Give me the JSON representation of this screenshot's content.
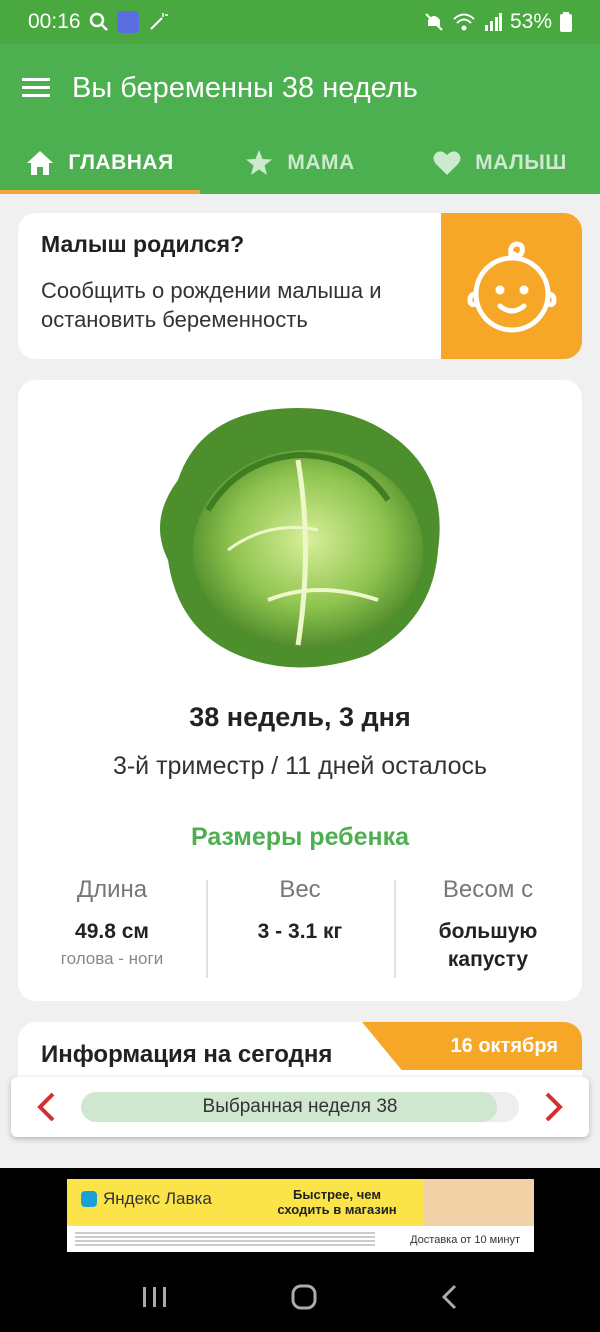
{
  "status_bar": {
    "time": "00:16",
    "battery": "53%"
  },
  "app_bar": {
    "title": "Вы беременны 38 недель"
  },
  "tabs": [
    {
      "label": "ГЛАВНАЯ",
      "icon": "home-icon",
      "active": true
    },
    {
      "label": "МАМА",
      "icon": "star-icon",
      "active": false
    },
    {
      "label": "МАЛЫШ",
      "icon": "heart-icon",
      "active": false
    }
  ],
  "birth_card": {
    "title": "Малыш родился?",
    "text": "Сообщить о рождении малыша и остановить беременность",
    "icon": "baby-face-icon"
  },
  "progress": {
    "fruit_icon": "cabbage-icon",
    "weeks_text": "38 недель, 3 дня",
    "trimester_text": "3-й триместр / 11 дней осталось",
    "sizes_title": "Размеры ребенка",
    "stats": [
      {
        "label": "Длина",
        "value": "49.8 см",
        "sub": "голова - ноги"
      },
      {
        "label": "Вес",
        "value": "3 - 3.1 кг",
        "sub": ""
      },
      {
        "label": "Весом с",
        "value": "большую капусту",
        "sub": ""
      }
    ]
  },
  "info": {
    "title": "Информация на сегодня",
    "date": "16 октября"
  },
  "week_selector": {
    "label": "Выбранная неделя 38",
    "fill_fraction": 0.95
  },
  "ad": {
    "brand": "Яндекс Лавка",
    "slogan": "Быстрее, чем сходить в магазин",
    "delivery": "Доставка от 10 минут"
  },
  "colors": {
    "primary_green": "#4caf50",
    "status_green": "#49a83f",
    "accent_orange": "#f7a727",
    "arrow_red": "#d32f2f"
  }
}
